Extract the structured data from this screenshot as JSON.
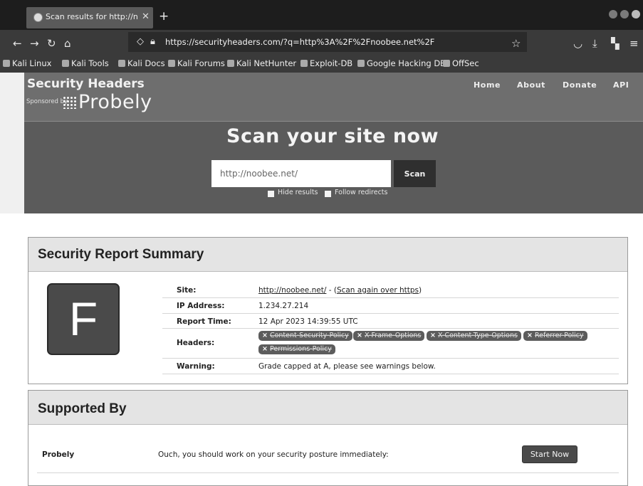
{
  "browser": {
    "tab_title": "Scan results for http://noob",
    "new_tab": "+",
    "url": "https://securityheaders.com/?q=http%3A%2F%2Fnoobee.net%2F",
    "bookmarks": [
      "Kali Linux",
      "Kali Tools",
      "Kali Docs",
      "Kali Forums",
      "Kali NetHunter",
      "Exploit-DB",
      "Google Hacking DB",
      "OffSec"
    ]
  },
  "site": {
    "brand": "Security Headers",
    "sponsored_by": "Sponsored by",
    "sponsor": "Probely",
    "nav": [
      "Home",
      "About",
      "Donate",
      "API"
    ],
    "heading": "Scan your site now",
    "scan_value": "http://noobee.net/",
    "scan_button": "Scan",
    "hide_results": "Hide results",
    "follow_redirects": "Follow redirects"
  },
  "report": {
    "title": "Security Report Summary",
    "grade": "F",
    "rows": {
      "site_label": "Site:",
      "site_url": "http://noobee.net/",
      "site_sep": " - (",
      "site_rescan": "Scan again over https",
      "site_close": ")",
      "ip_label": "IP Address:",
      "ip_value": "1.234.27.214",
      "time_label": "Report Time:",
      "time_value": "12 Apr 2023 14:39:55 UTC",
      "headers_label": "Headers:",
      "warning_label": "Warning:",
      "warning_value": "Grade capped at A, please see warnings below."
    },
    "headers": [
      "Content-Security-Policy",
      "X-Frame-Options",
      "X-Content-Type-Options",
      "Referrer-Policy",
      "Permissions-Policy"
    ]
  },
  "supported": {
    "title": "Supported By",
    "name": "Probely",
    "message": "Ouch, you should work on your security posture immediately:",
    "button": "Start Now"
  },
  "colors": {
    "header_bg": "#5b5b5b",
    "grade_bg": "#4a4a4a",
    "panel_head": "#e4e4e4"
  }
}
